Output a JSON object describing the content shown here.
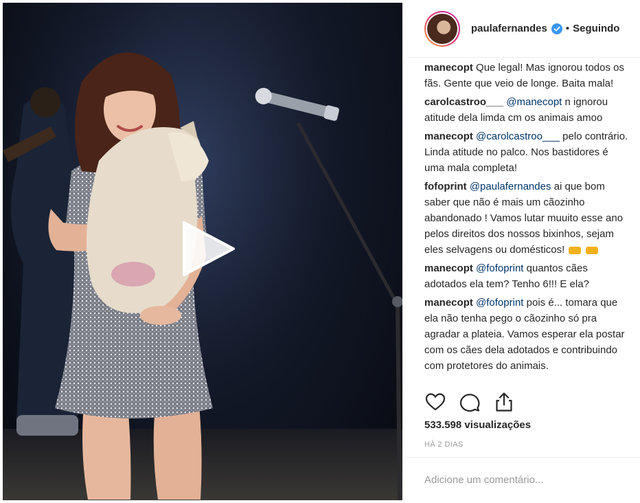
{
  "post": {
    "username": "paulafernandes",
    "verified": true,
    "separator": "•",
    "follow_status": "Seguindo"
  },
  "comments": [
    {
      "user": "manecopt",
      "mention": "",
      "text": "Que legal! Mas ignorou todos os fãs. Gente que veio de longe. Baita mala!"
    },
    {
      "user": "carolcastroo___",
      "mention": "@manecopt",
      "text": "n ignorou atitude dela limda cm os animais amoo"
    },
    {
      "user": "manecopt",
      "mention": "@carolcastroo___",
      "text": "pelo contrário. Linda atitude no palco. Nos bastidores é uma mala completa!"
    },
    {
      "user": "fofoprint",
      "mention": "@paulafernandes",
      "text": "ai que bom saber que não é mais um cãozinho abandonado ! Vamos lutar muuito esse ano pelos direitos dos nossos bixinhos, sejam eles selvagens ou domésticos!"
    },
    {
      "user": "manecopt",
      "mention": "@fofoprint",
      "text": "quantos cães adotados ela tem? Tenho 6!!! E ela?"
    },
    {
      "user": "manecopt",
      "mention": "@fofoprint",
      "text": "pois é... tomara que ela não tenha pego o cãozinho só pra agradar a plateia. Vamos esperar ela postar com os cães dela adotados e contribuindo com protetores do animais."
    }
  ],
  "stats": {
    "views": "533.598 visualizações",
    "time_ago": "HÁ 2 DIAS"
  },
  "composer": {
    "placeholder": "Adicione um comentário..."
  },
  "icons": {
    "like": "heart-icon",
    "comment": "comment-bubble-icon",
    "share": "share-icon",
    "play": "play-icon",
    "verified": "verified-badge-icon"
  },
  "colors": {
    "verified_badge": "#3897f0",
    "mention": "#003569",
    "muted": "#999999",
    "text": "#262626"
  }
}
